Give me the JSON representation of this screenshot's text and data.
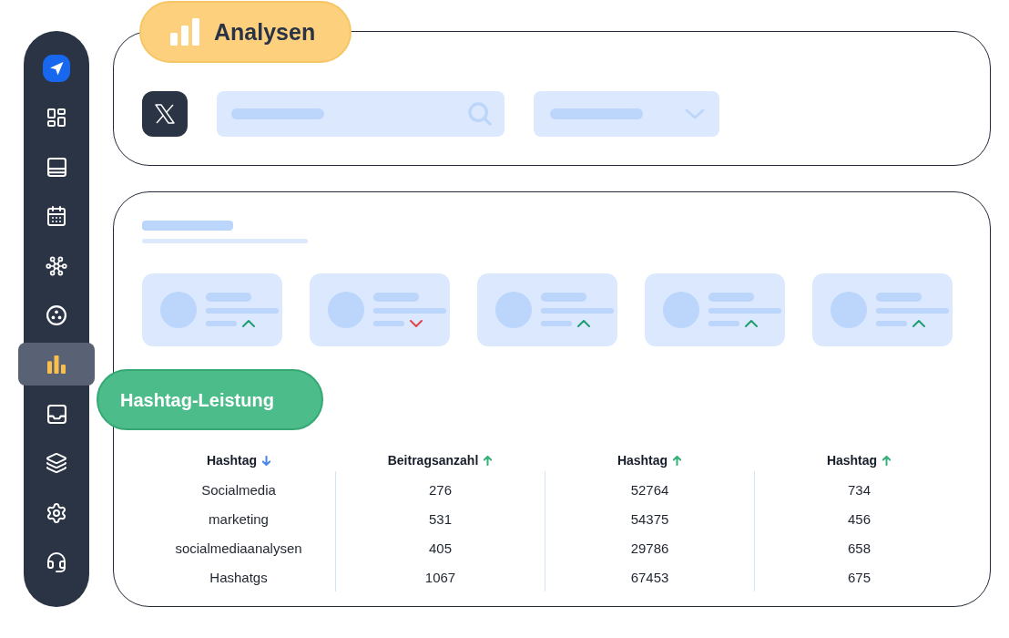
{
  "sidebar": {
    "items": [
      {
        "selected": false
      },
      {
        "selected": false
      },
      {
        "selected": false
      },
      {
        "selected": false
      },
      {
        "selected": false
      },
      {
        "selected": true
      },
      {
        "selected": false
      },
      {
        "selected": false
      },
      {
        "selected": false
      },
      {
        "selected": false
      }
    ]
  },
  "header": {
    "title": "Analysen"
  },
  "stat_cards": [
    {
      "rising": true
    },
    {
      "rising": false
    },
    {
      "rising": true
    },
    {
      "rising": true
    },
    {
      "rising": true
    }
  ],
  "section": {
    "title": "Hashtag-Leistung"
  },
  "table": {
    "columns": [
      {
        "label": "Hashtag",
        "descending": true
      },
      {
        "label": "Beitragsanzahl",
        "descending": false
      },
      {
        "label": "Hashtag",
        "descending": false
      },
      {
        "label": "Hashtag",
        "descending": false
      }
    ],
    "rows": [
      [
        "Socialmedia",
        "276",
        "52764",
        "734"
      ],
      [
        "marketing",
        "531",
        "54375",
        "456"
      ],
      [
        "socialmediaanalysen",
        "405",
        "29786",
        "658"
      ],
      [
        "Hashatgs",
        "1067",
        "67453",
        "675"
      ]
    ]
  }
}
